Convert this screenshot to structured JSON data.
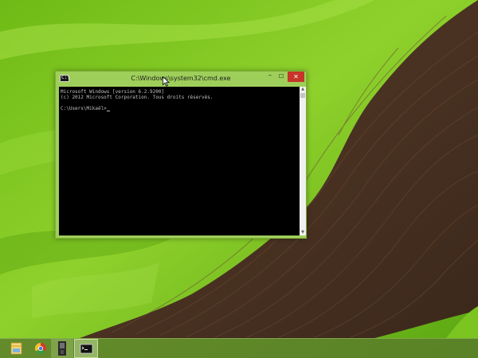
{
  "window": {
    "title": "C:\\Windows\\system32\\cmd.exe",
    "app_icon_glyph": "C:\\",
    "minimize_glyph": "–",
    "maximize_glyph": "☐",
    "close_glyph": "✕"
  },
  "console": {
    "lines": [
      "Microsoft Windows [version 6.2.9200]",
      "(c) 2012 Microsoft Corporation. Tous droits réservés."
    ],
    "prompt": "C:\\Users\\Mikaël>"
  },
  "scrollbar": {
    "up_arrow": "▲",
    "down_arrow": "▼"
  },
  "taskbar": {
    "items": [
      {
        "icon": "file-explorer-icon"
      },
      {
        "icon": "chrome-icon"
      },
      {
        "icon": "app-icon"
      },
      {
        "icon": "command-prompt-icon",
        "active": true
      }
    ]
  },
  "colors": {
    "window_frame": "#9fcf5b",
    "close_button": "#c7352a",
    "console_background": "#000000",
    "console_text": "#c0c0c0",
    "wallpaper_green": "#7cc41f",
    "wallpaper_soil": "#4e3524"
  }
}
